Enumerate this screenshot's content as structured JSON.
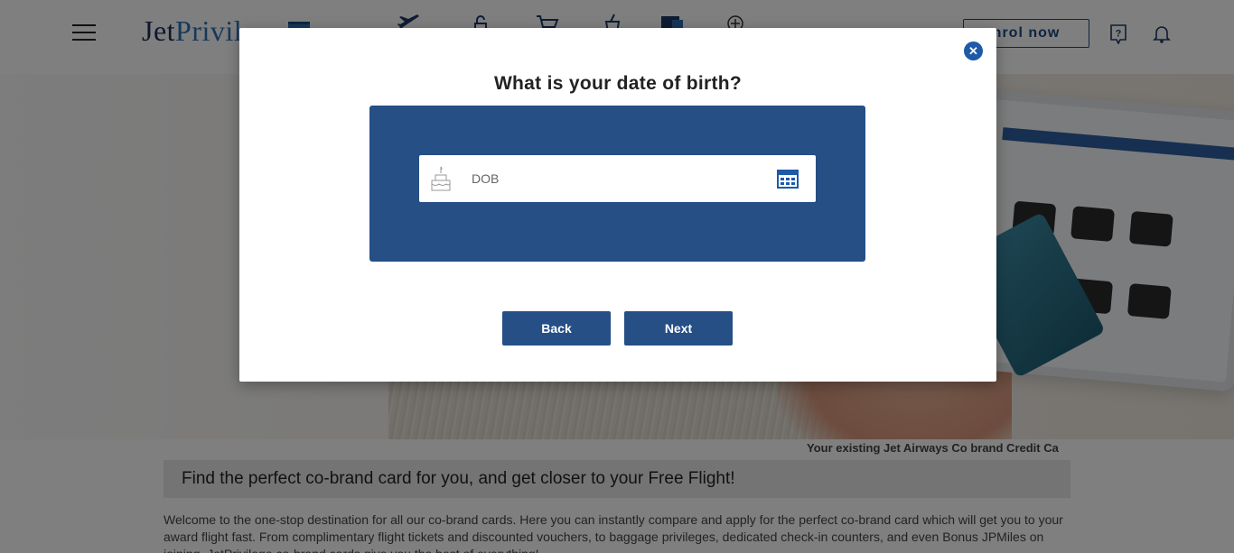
{
  "header": {
    "logo_part1": "Jet",
    "logo_part2": "Privil",
    "enrol_label": "nrol now",
    "nav_icons": [
      "card-icon",
      "plane-icon",
      "lock-icon",
      "cart-icon",
      "shopping-bag-icon",
      "chat-icon",
      "plus-icon"
    ],
    "help_icon": "question-icon",
    "bell_icon": "bell-icon"
  },
  "hero": {
    "caption": "Your existing Jet Airways Co brand Credit Ca"
  },
  "content": {
    "banner": "Find the perfect co-brand card for you, and get closer to your Free Flight!",
    "intro": "Welcome to the one-stop destination for all our co-brand cards. Here you can instantly compare and apply for the perfect co-brand card which will get you to your award flight fast. From complimentary flight tickets and discounted vouchers, to baggage privileges, dedicated check-in counters, and even Bonus JPMiles on joining, JetPrivilege co-brand cards give you the best of everything!"
  },
  "modal": {
    "close_icon": "close-icon",
    "title": "What is your date of birth?",
    "dob_placeholder": "DOB",
    "dob_value": "",
    "cake_icon": "birthday-cake-icon",
    "calendar_icon": "calendar-icon",
    "back_label": "Back",
    "next_label": "Next"
  },
  "colors": {
    "primary": "#254f85",
    "close": "#1d5aa8",
    "overlay": "rgba(0,0,0,0.5)"
  }
}
